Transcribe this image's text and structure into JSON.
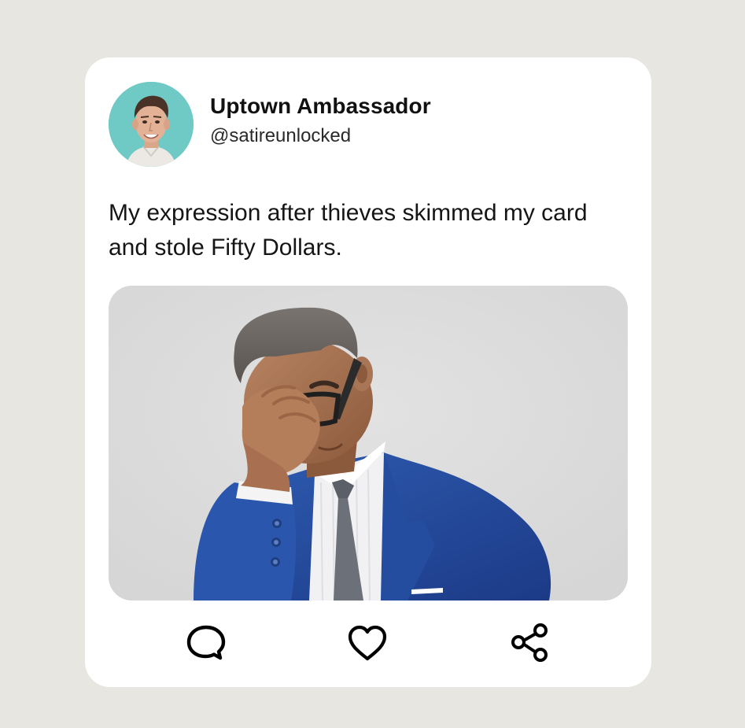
{
  "post": {
    "author": {
      "display_name": "Uptown Ambassador",
      "handle": "@satireunlocked",
      "avatar_icon": "profile-photo"
    },
    "text": "My expression after thieves skimmed my card and stole Fifty Dollars.",
    "media": {
      "subject": "3d-businessman-facepalm-illustration"
    },
    "actions": [
      {
        "name": "comment",
        "icon": "speech-bubble-icon"
      },
      {
        "name": "like",
        "icon": "heart-icon"
      },
      {
        "name": "share",
        "icon": "share-icon"
      }
    ]
  },
  "colors": {
    "page_background": "#e8e6e1",
    "card_background": "#ffffff",
    "avatar_background": "#6fcac6",
    "media_background": "#dcdcdc",
    "text": "#111111"
  }
}
